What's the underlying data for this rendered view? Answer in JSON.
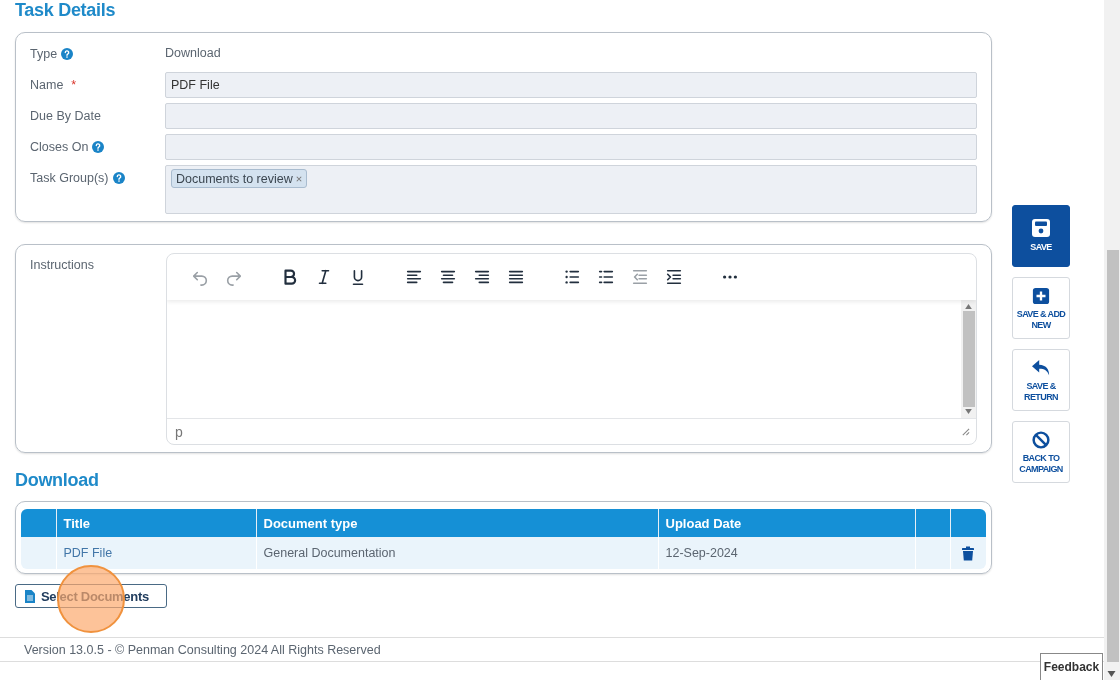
{
  "task_details": {
    "heading": "Task Details",
    "fields": [
      {
        "kind": "static",
        "label": "Type",
        "help": true,
        "value": "Download"
      },
      {
        "kind": "input",
        "label": "Name",
        "required_mark": "*",
        "help": false,
        "value": "PDF File"
      },
      {
        "kind": "input",
        "label": "Due By Date",
        "help": false
      },
      {
        "kind": "input",
        "label": "Closes On",
        "help": true
      },
      {
        "kind": "tags",
        "label": "Task Group(s)",
        "help": true,
        "tags": [
          "Documents to review"
        ]
      }
    ]
  },
  "instructions": {
    "label": "Instructions",
    "toolbar": [
      {
        "kind": "undo",
        "disabled": true
      },
      {
        "kind": "redo",
        "disabled": true
      },
      {
        "kind": "sep"
      },
      {
        "kind": "bold",
        "disabled": false
      },
      {
        "kind": "italic",
        "disabled": false
      },
      {
        "kind": "underline",
        "disabled": false
      },
      {
        "kind": "sep"
      },
      {
        "kind": "align-left",
        "disabled": false
      },
      {
        "kind": "align-center",
        "disabled": false
      },
      {
        "kind": "align-right",
        "disabled": false
      },
      {
        "kind": "justify",
        "disabled": false
      },
      {
        "kind": "sep"
      },
      {
        "kind": "bullets",
        "disabled": false
      },
      {
        "kind": "numbers",
        "disabled": false
      },
      {
        "kind": "outdent",
        "disabled": true
      },
      {
        "kind": "indent",
        "disabled": false
      },
      {
        "kind": "sep"
      },
      {
        "kind": "more",
        "disabled": false
      }
    ],
    "status_path": "p"
  },
  "download": {
    "heading": "Download",
    "table": {
      "columns": [
        "Title",
        "Document type",
        "Upload Date"
      ],
      "rows": [
        {
          "title": "PDF File",
          "document_type": "General Documentation",
          "upload_date": "12-Sep-2024"
        }
      ]
    },
    "select_button": "Select Documents",
    "click_highlight": true
  },
  "actions": [
    {
      "kind": "save",
      "label": "SAVE",
      "primary": true
    },
    {
      "kind": "add",
      "label": "SAVE & ADD NEW",
      "primary": false
    },
    {
      "kind": "return",
      "label": "SAVE & RETURN",
      "primary": false
    },
    {
      "kind": "cancel",
      "label": "BACK TO CAMPAIGN",
      "primary": false
    }
  ],
  "footer": "Version 13.0.5 - © Penman Consulting 2024 All Rights Reserved",
  "feedback": "Feedback"
}
